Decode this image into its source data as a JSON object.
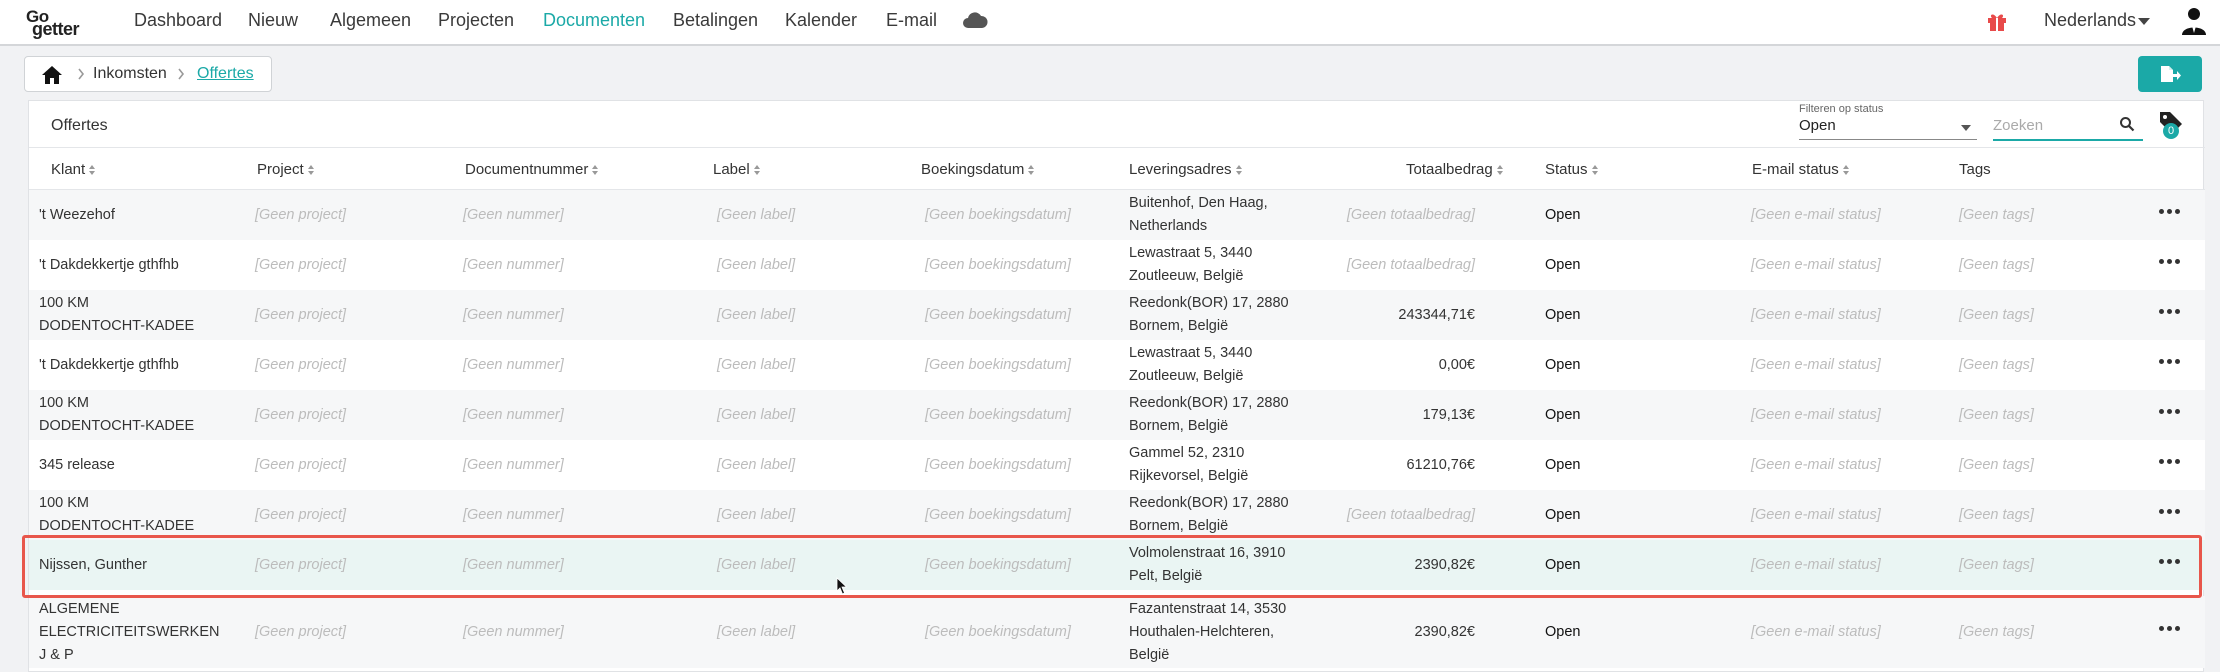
{
  "nav": {
    "logo_top": "Go",
    "logo_bottom": "getter",
    "items": [
      "Dashboard",
      "Nieuw",
      "Algemeen",
      "Projecten",
      "Documenten",
      "Betalingen",
      "Kalender",
      "E-mail"
    ],
    "active_item": "Documenten",
    "language": "Nederlands"
  },
  "breadcrumb": {
    "parent": "Inkomsten",
    "current": "Offertes"
  },
  "panel": {
    "title": "Offertes",
    "filter_label": "Filteren op status",
    "filter_value": "Open",
    "search_placeholder": "Zoeken",
    "tag_count": "0"
  },
  "columns": [
    "Klant",
    "Project",
    "Documentnummer",
    "Label",
    "Boekingsdatum",
    "Leveringsadres",
    "Totaalbedrag",
    "Status",
    "E-mail status",
    "Tags"
  ],
  "rows": [
    {
      "klant": [
        "'t Weezehof"
      ],
      "project": "[Geen project]",
      "nummer": "[Geen nummer]",
      "label": "[Geen label]",
      "datum": "[Geen boekingsdatum]",
      "adres": [
        "Buitenhof, Den Haag,",
        "Netherlands"
      ],
      "bedrag": "[Geen totaalbedrag]",
      "status": "Open",
      "email": "[Geen e-mail status]",
      "tags": "[Geen tags]"
    },
    {
      "klant": [
        "'t Dakdekkertje gthfhb"
      ],
      "project": "[Geen project]",
      "nummer": "[Geen nummer]",
      "label": "[Geen label]",
      "datum": "[Geen boekingsdatum]",
      "adres": [
        "Lewastraat 5, 3440",
        "Zoutleeuw, België"
      ],
      "bedrag": "[Geen totaalbedrag]",
      "status": "Open",
      "email": "[Geen e-mail status]",
      "tags": "[Geen tags]"
    },
    {
      "klant": [
        "100 KM",
        "DODENTOCHT-KADEE"
      ],
      "project": "[Geen project]",
      "nummer": "[Geen nummer]",
      "label": "[Geen label]",
      "datum": "[Geen boekingsdatum]",
      "adres": [
        "Reedonk(BOR) 17, 2880",
        "Bornem, België"
      ],
      "bedrag": "243344,71€",
      "status": "Open",
      "email": "[Geen e-mail status]",
      "tags": "[Geen tags]"
    },
    {
      "klant": [
        "'t Dakdekkertje gthfhb"
      ],
      "project": "[Geen project]",
      "nummer": "[Geen nummer]",
      "label": "[Geen label]",
      "datum": "[Geen boekingsdatum]",
      "adres": [
        "Lewastraat 5, 3440",
        "Zoutleeuw, België"
      ],
      "bedrag": "0,00€",
      "status": "Open",
      "email": "[Geen e-mail status]",
      "tags": "[Geen tags]"
    },
    {
      "klant": [
        "100 KM",
        "DODENTOCHT-KADEE"
      ],
      "project": "[Geen project]",
      "nummer": "[Geen nummer]",
      "label": "[Geen label]",
      "datum": "[Geen boekingsdatum]",
      "adres": [
        "Reedonk(BOR) 17, 2880",
        "Bornem, België"
      ],
      "bedrag": "179,13€",
      "status": "Open",
      "email": "[Geen e-mail status]",
      "tags": "[Geen tags]"
    },
    {
      "klant": [
        "345 release"
      ],
      "project": "[Geen project]",
      "nummer": "[Geen nummer]",
      "label": "[Geen label]",
      "datum": "[Geen boekingsdatum]",
      "adres": [
        "Gammel 52, 2310",
        "Rijkevorsel, België"
      ],
      "bedrag": "61210,76€",
      "status": "Open",
      "email": "[Geen e-mail status]",
      "tags": "[Geen tags]"
    },
    {
      "klant": [
        "100 KM",
        "DODENTOCHT-KADEE"
      ],
      "project": "[Geen project]",
      "nummer": "[Geen nummer]",
      "label": "[Geen label]",
      "datum": "[Geen boekingsdatum]",
      "adres": [
        "Reedonk(BOR) 17, 2880",
        "Bornem, België"
      ],
      "bedrag": "[Geen totaalbedrag]",
      "status": "Open",
      "email": "[Geen e-mail status]",
      "tags": "[Geen tags]"
    },
    {
      "klant": [
        "Nijssen, Gunther"
      ],
      "project": "[Geen project]",
      "nummer": "[Geen nummer]",
      "label": "[Geen label]",
      "datum": "[Geen boekingsdatum]",
      "adres": [
        "Volmolenstraat 16, 3910",
        "Pelt, België"
      ],
      "bedrag": "2390,82€",
      "status": "Open",
      "email": "[Geen e-mail status]",
      "tags": "[Geen tags]",
      "selected": true
    },
    {
      "klant": [
        "ALGEMENE",
        "ELECTRICITEITSWERKEN",
        "J & P"
      ],
      "project": "[Geen project]",
      "nummer": "[Geen nummer]",
      "label": "[Geen label]",
      "datum": "[Geen boekingsdatum]",
      "adres": [
        "Fazantenstraat 14, 3530",
        "Houthalen-Helchteren,",
        "België"
      ],
      "bedrag": "2390,82€",
      "status": "Open",
      "email": "[Geen e-mail status]",
      "tags": "[Geen tags]"
    }
  ],
  "colors": {
    "accent": "#1ba9a7",
    "selection_outline": "#e8564b",
    "selected_row": "#eaf5f3",
    "gift": "#e84a4a"
  }
}
